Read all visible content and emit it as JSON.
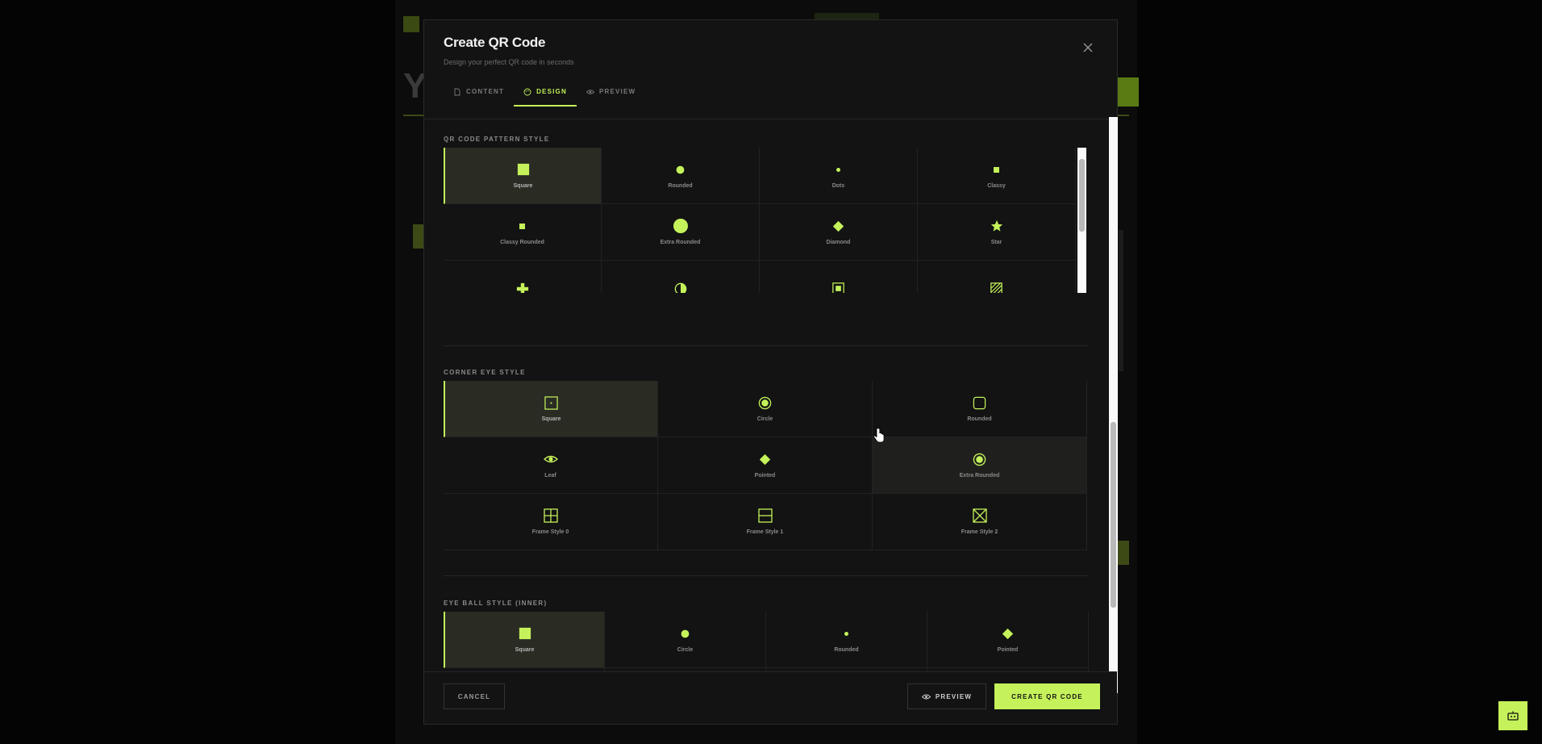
{
  "modal": {
    "title": "Create QR Code",
    "subtitle": "Design your perfect QR code in seconds",
    "close_icon": "close-icon",
    "tabs": [
      {
        "label": "CONTENT",
        "icon": "document-icon",
        "active": false
      },
      {
        "label": "DESIGN",
        "icon": "palette-icon",
        "active": true
      },
      {
        "label": "PREVIEW",
        "icon": "eye-icon",
        "active": false
      }
    ]
  },
  "pattern": {
    "label": "QR CODE PATTERN STYLE",
    "options": [
      {
        "label": "Square",
        "icon": "square-icon",
        "selected": true
      },
      {
        "label": "Rounded",
        "icon": "dot-icon"
      },
      {
        "label": "Dots",
        "icon": "small-dot-icon"
      },
      {
        "label": "Classy",
        "icon": "small-square-icon"
      },
      {
        "label": "Classy Rounded",
        "icon": "small-square-icon"
      },
      {
        "label": "Extra Rounded",
        "icon": "circle-icon"
      },
      {
        "label": "Diamond",
        "icon": "diamond-icon"
      },
      {
        "label": "Star",
        "icon": "star-icon"
      },
      {
        "label": "",
        "icon": "plus-icon"
      },
      {
        "label": "",
        "icon": "half-circle-icon"
      },
      {
        "label": "",
        "icon": "framed-square-icon"
      },
      {
        "label": "",
        "icon": "hatched-square-icon"
      }
    ]
  },
  "corner_eye": {
    "label": "CORNER EYE STYLE",
    "options": [
      {
        "label": "Square",
        "icon": "square-eye-icon",
        "selected": true
      },
      {
        "label": "Circle",
        "icon": "circle-eye-icon"
      },
      {
        "label": "Rounded",
        "icon": "rounded-square-icon"
      },
      {
        "label": "Leaf",
        "icon": "eye-icon"
      },
      {
        "label": "Pointed",
        "icon": "diamond-icon"
      },
      {
        "label": "Extra Rounded",
        "icon": "circle-eye-icon",
        "hover": true
      },
      {
        "label": "Frame Style 0",
        "icon": "grid-frame-icon"
      },
      {
        "label": "Frame Style 1",
        "icon": "split-frame-icon"
      },
      {
        "label": "Frame Style 2",
        "icon": "cross-frame-icon"
      }
    ]
  },
  "eye_ball": {
    "label": "EYE BALL STYLE (INNER)",
    "options": [
      {
        "label": "Square",
        "icon": "square-icon",
        "selected": true
      },
      {
        "label": "Circle",
        "icon": "dot-icon"
      },
      {
        "label": "Rounded",
        "icon": "small-dot-icon"
      },
      {
        "label": "Pointed",
        "icon": "diamond-icon"
      },
      {
        "label": "",
        "icon": "circle-icon"
      },
      {
        "label": "",
        "icon": "eye-icon"
      },
      {
        "label": "",
        "icon": "triangle-left-icon"
      },
      {
        "label": "",
        "icon": "triangle-right-icon"
      }
    ]
  },
  "footer": {
    "cancel": "CANCEL",
    "preview": "PREVIEW",
    "create": "CREATE QR CODE"
  },
  "colors": {
    "accent": "#c5f25a",
    "modal_bg": "#121312",
    "selected_bg": "#2a2c24"
  }
}
